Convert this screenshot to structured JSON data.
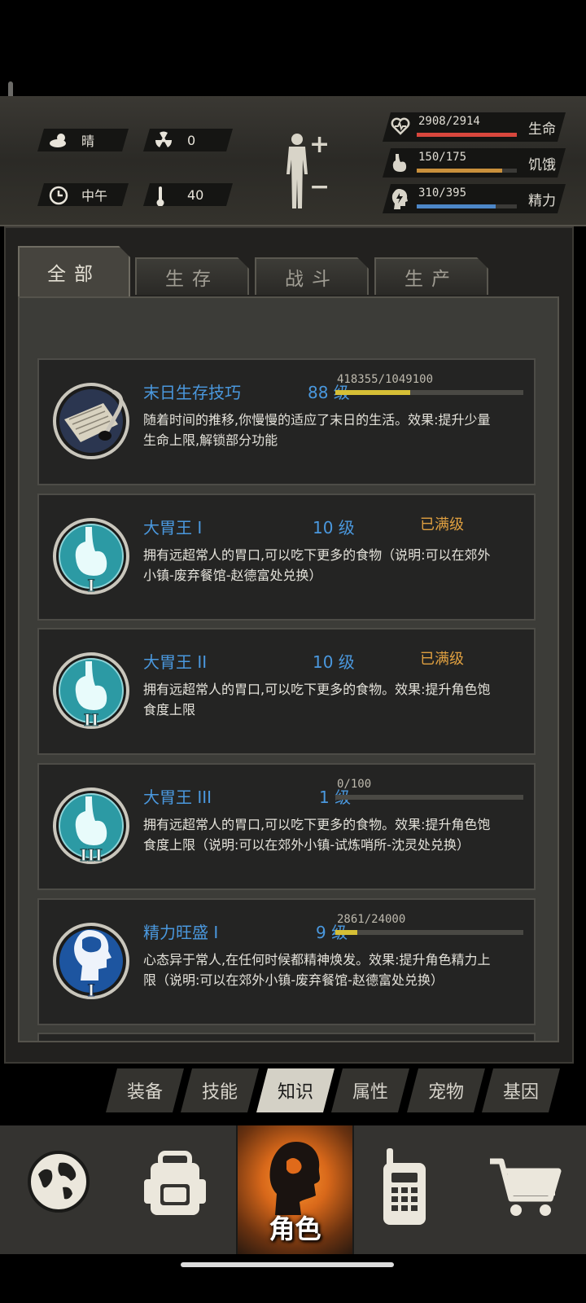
{
  "top": {
    "weather": "晴",
    "radiation": "0",
    "time_of_day": "中午",
    "temperature": "40",
    "vitals": [
      {
        "label": "生命",
        "value": "2908/2914",
        "fraction": 0.998,
        "color": "#d9473d",
        "icon": "heart-icon"
      },
      {
        "label": "饥饿",
        "value": "150/175",
        "fraction": 0.857,
        "color": "#c9903c",
        "icon": "stomach-icon"
      },
      {
        "label": "精力",
        "value": "310/395",
        "fraction": 0.785,
        "color": "#4d87c8",
        "icon": "energy-head-icon"
      }
    ]
  },
  "tabs": [
    {
      "label": "全部",
      "active": true
    },
    {
      "label": "生存",
      "active": false
    },
    {
      "label": "战斗",
      "active": false
    },
    {
      "label": "生产",
      "active": false
    }
  ],
  "skills": [
    {
      "name": "末日生存技巧",
      "level": "88 级",
      "xp": "418355/1049100",
      "xp_fraction": 0.399,
      "maxed": "",
      "description": "随着时间的推移,你慢慢的适应了末日的生活。效果:提升少量生命上限,解锁部分功能",
      "icon": "scroll-quill-icon"
    },
    {
      "name": "大胃王 I",
      "level": "10 级",
      "xp": "",
      "xp_fraction": null,
      "maxed": "已满级",
      "description": "拥有远超常人的胃口,可以吃下更多的食物（说明:可以在郊外小镇-废弃餐馆-赵德富处兑换）",
      "icon": "stomach-icon",
      "roman": "I"
    },
    {
      "name": "大胃王 II",
      "level": "10 级",
      "xp": "",
      "xp_fraction": null,
      "maxed": "已满级",
      "description": "拥有远超常人的胃口,可以吃下更多的食物。效果:提升角色饱食度上限",
      "icon": "stomach-icon",
      "roman": "II"
    },
    {
      "name": "大胃王 III",
      "level": "1 级",
      "xp": "0/100",
      "xp_fraction": 0,
      "maxed": "",
      "description": "拥有远超常人的胃口,可以吃下更多的食物。效果:提升角色饱食度上限（说明:可以在郊外小镇-试炼哨所-沈灵处兑换）",
      "icon": "stomach-icon",
      "roman": "III"
    },
    {
      "name": "精力旺盛 I",
      "level": "9 级",
      "xp": "2861/24000",
      "xp_fraction": 0.119,
      "maxed": "",
      "description": "心态异于常人,在任何时候都精神焕发。效果:提升角色精力上限（说明:可以在郊外小镇-废弃餐馆-赵德富处兑换）",
      "icon": "brain-head-icon",
      "roman": "I"
    }
  ],
  "subtabs": [
    {
      "label": "装备",
      "active": false
    },
    {
      "label": "技能",
      "active": false
    },
    {
      "label": "知识",
      "active": true
    },
    {
      "label": "属性",
      "active": false
    },
    {
      "label": "宠物",
      "active": false
    },
    {
      "label": "基因",
      "active": false
    }
  ],
  "nav": {
    "active_label": "角色",
    "items": [
      "globe-icon",
      "backpack-icon",
      "character-icon",
      "radio-icon",
      "cart-icon"
    ]
  }
}
